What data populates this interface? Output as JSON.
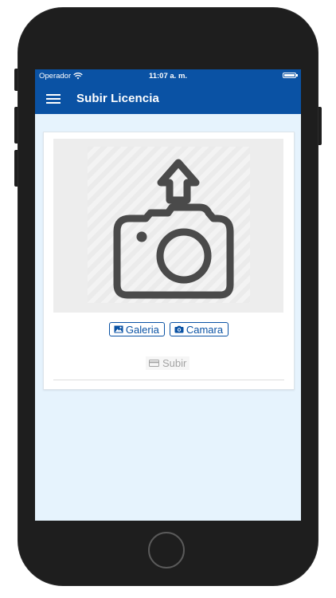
{
  "statusbar": {
    "carrier": "Operador",
    "time": "11:07 a. m."
  },
  "navbar": {
    "title": "Subir Licencia",
    "menu_icon": "hamburger-menu-icon"
  },
  "card": {
    "preview_icon": "camera-upload-icon",
    "gallery_button_label": "Galeria",
    "gallery_icon": "image-icon",
    "camera_button_label": "Camara",
    "camera_icon": "camera-icon",
    "upload_button_label": "Subir",
    "upload_icon": "card-icon"
  },
  "colors": {
    "primary": "#0a52a4",
    "background": "#e6f3fd",
    "icon": "#4a4a4a",
    "disabled": "#a3a3a3"
  }
}
